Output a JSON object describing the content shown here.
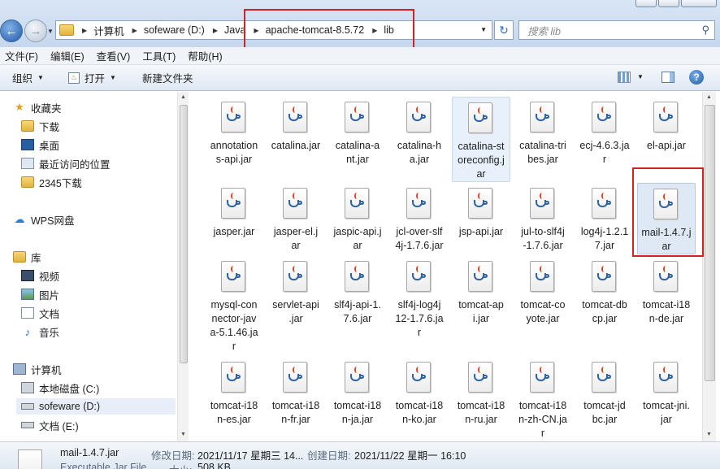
{
  "address": {
    "crumbs": [
      "计算机",
      "sofeware (D:)",
      "Java",
      "apache-tomcat-8.5.72",
      "lib"
    ],
    "search_placeholder": "搜索 lib"
  },
  "menu": [
    "文件(F)",
    "编辑(E)",
    "查看(V)",
    "工具(T)",
    "帮助(H)"
  ],
  "toolbar": {
    "organize": "组织",
    "open": "打开",
    "new_folder": "新建文件夹"
  },
  "nav": {
    "favorites": "收藏夹",
    "downloads": "下载",
    "desktop": "桌面",
    "recent": "最近访问的位置",
    "d2345": "2345下载",
    "wps": "WPS网盘",
    "library": "库",
    "video": "视频",
    "pictures": "图片",
    "documents": "文档",
    "music": "音乐",
    "computer": "计算机",
    "drive_c": "本地磁盘 (C:)",
    "drive_d": "sofeware (D:)",
    "drive_e": "文档 (E:)"
  },
  "files": [
    "annotations-api.jar",
    "catalina.jar",
    "catalina-ant.jar",
    "catalina-ha.jar",
    "catalina-storeconfig.jar",
    "catalina-tribes.jar",
    "ecj-4.6.3.jar",
    "el-api.jar",
    "jasper.jar",
    "jasper-el.jar",
    "jaspic-api.jar",
    "jcl-over-slf4j-1.7.6.jar",
    "jsp-api.jar",
    "jul-to-slf4j-1.7.6.jar",
    "log4j-1.2.17.jar",
    "mail-1.4.7.jar",
    "mysql-connector-java-5.1.46.jar",
    "servlet-api.jar",
    "slf4j-api-1.7.6.jar",
    "slf4j-log4j12-1.7.6.jar",
    "tomcat-api.jar",
    "tomcat-coyote.jar",
    "tomcat-dbcp.jar",
    "tomcat-i18n-de.jar",
    "tomcat-i18n-es.jar",
    "tomcat-i18n-fr.jar",
    "tomcat-i18n-ja.jar",
    "tomcat-i18n-ko.jar",
    "tomcat-i18n-ru.jar",
    "tomcat-i18n-zh-CN.jar",
    "tomcat-jdbc.jar",
    "tomcat-jni.jar"
  ],
  "file_labels": [
    "annotation s-api.jar",
    "catalina.jar",
    "catalina-a nt.jar",
    "catalina-h a.jar",
    "catalina-st oreconfig.j ar",
    "catalina-tri bes.jar",
    "ecj-4.6.3.ja r",
    "el-api.jar",
    "jasper.jar",
    "jasper-el.j ar",
    "jaspic-api.j ar",
    "jcl-over-slf 4j-1.7.6.jar",
    "jsp-api.jar",
    "jul-to-slf4j -1.7.6.jar",
    "log4j-1.2.1 7.jar",
    "mail-1.4.7.j ar",
    "mysql-con nector-jav a-5.1.46.ja r",
    "servlet-api .jar",
    "slf4j-api-1. 7.6.jar",
    "slf4j-log4j 12-1.7.6.ja r",
    "tomcat-ap i.jar",
    "tomcat-co yote.jar",
    "tomcat-db cp.jar",
    "tomcat-i18 n-de.jar",
    "tomcat-i18 n-es.jar",
    "tomcat-i18 n-fr.jar",
    "tomcat-i18 n-ja.jar",
    "tomcat-i18 n-ko.jar",
    "tomcat-i18 n-ru.jar",
    "tomcat-i18 n-zh-CN.ja r",
    "tomcat-jd bc.jar",
    "tomcat-jni. jar"
  ],
  "details": {
    "name": "mail-1.4.7.jar",
    "type": "Executable Jar File",
    "modified_label": "修改日期:",
    "modified_value": "2021/11/17 星期三 14...",
    "created_label": "创建日期:",
    "created_value": "2021/11/22 星期一 16:10",
    "size_label": "大小:",
    "size_value": "508 KB"
  }
}
